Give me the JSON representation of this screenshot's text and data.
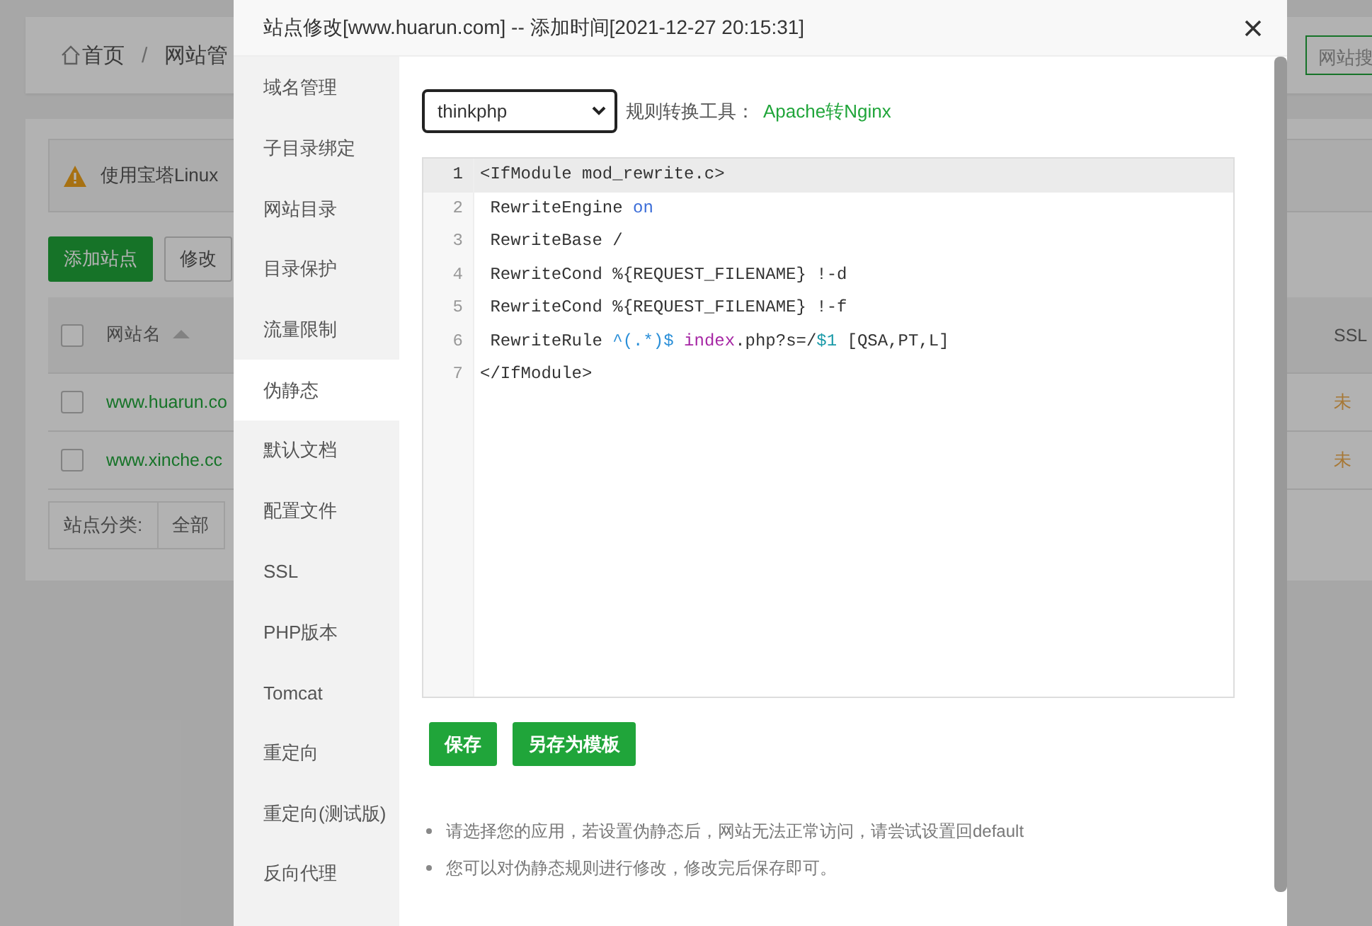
{
  "background_page": {
    "breadcrumb": [
      {
        "text": "首页",
        "kind": "home"
      },
      {
        "text": "/",
        "kind": "separator"
      },
      {
        "text": "网站管",
        "kind": "link"
      }
    ],
    "search_placeholder": "网站搜",
    "notice": "使用宝塔Linux",
    "toolbar_buttons": [
      {
        "label": "添加站点",
        "kind": "primary"
      },
      {
        "label": "修改",
        "kind": "default"
      }
    ],
    "table": {
      "header_checked": false,
      "columns": [
        "网站名",
        "SSL"
      ],
      "rows": [
        {
          "name": "www.huarun.co",
          "ssl": "未",
          "checked": false
        },
        {
          "name": "www.xinche.cc",
          "ssl": "未",
          "checked": false
        }
      ]
    },
    "category": {
      "label": "站点分类:",
      "value": "全部"
    }
  },
  "dialog": {
    "title": "站点修改[www.huarun.com] -- 添加时间[2021-12-27 20:15:31]",
    "sidebar": [
      {
        "label": "域名管理",
        "selected": false
      },
      {
        "label": "子目录绑定",
        "selected": false
      },
      {
        "label": "网站目录",
        "selected": false
      },
      {
        "label": "目录保护",
        "selected": false
      },
      {
        "label": "流量限制",
        "selected": false
      },
      {
        "label": "伪静态",
        "selected": true
      },
      {
        "label": "默认文档",
        "selected": false
      },
      {
        "label": "配置文件",
        "selected": false
      },
      {
        "label": "SSL",
        "selected": false
      },
      {
        "label": "PHP版本",
        "selected": false
      },
      {
        "label": "Tomcat",
        "selected": false
      },
      {
        "label": "重定向",
        "selected": false
      },
      {
        "label": "重定向(测试版)",
        "selected": false
      },
      {
        "label": "反向代理",
        "selected": false
      }
    ],
    "preset": "thinkphp",
    "tool_label": "规则转换工具：",
    "tool_link": "Apache转Nginx",
    "code_lines": [
      {
        "number": "1",
        "selected": true,
        "tokens": [
          {
            "text": "<IfModule mod_rewrite.c>",
            "kind": "plain"
          }
        ]
      },
      {
        "number": "2",
        "selected": false,
        "tokens": [
          {
            "text": " RewriteEngine ",
            "kind": "plain"
          },
          {
            "text": "on",
            "kind": "keyword"
          }
        ]
      },
      {
        "number": "3",
        "selected": false,
        "tokens": [
          {
            "text": " RewriteBase /",
            "kind": "plain"
          }
        ]
      },
      {
        "number": "4",
        "selected": false,
        "tokens": [
          {
            "text": " RewriteCond %{REQUEST_FILENAME} !-d",
            "kind": "plain"
          }
        ]
      },
      {
        "number": "5",
        "selected": false,
        "tokens": [
          {
            "text": " RewriteCond %{REQUEST_FILENAME} !-f",
            "kind": "plain"
          }
        ]
      },
      {
        "number": "6",
        "selected": false,
        "tokens": [
          {
            "text": " RewriteRule ",
            "kind": "plain"
          },
          {
            "text": "^(.*)$ ",
            "kind": "regex"
          },
          {
            "text": "index",
            "kind": "variable"
          },
          {
            "text": ".php?s=/",
            "kind": "plain"
          },
          {
            "text": "$1",
            "kind": "backref"
          },
          {
            "text": " [QSA,PT,L]",
            "kind": "plain"
          }
        ]
      },
      {
        "number": "7",
        "selected": false,
        "tokens": [
          {
            "text": "</IfModule>",
            "kind": "plain"
          }
        ]
      }
    ],
    "buttons": [
      "保存",
      "另存为模板"
    ],
    "notes": [
      "请选择您的应用，若设置伪静态后，网站无法正常访问，请尝试设置回default",
      "您可以对伪静态规则进行修改，修改完后保存即可。"
    ]
  }
}
